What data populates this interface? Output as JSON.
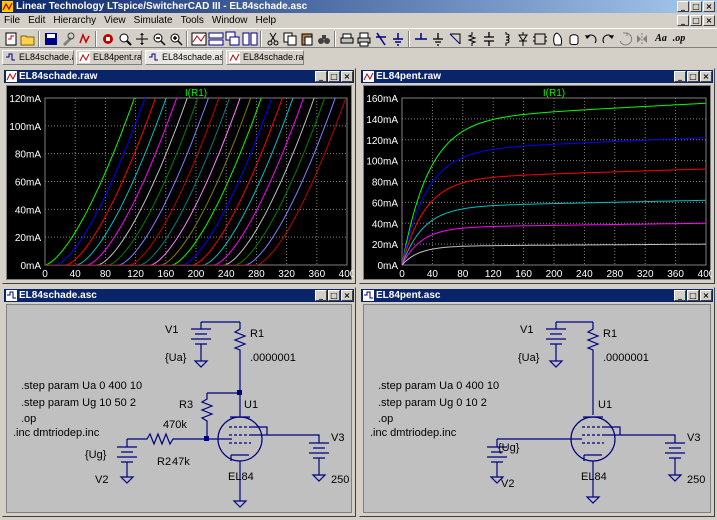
{
  "app": {
    "title": "Linear Technology LTspice/SwitcherCAD III - EL84schade.asc"
  },
  "menu": [
    "File",
    "Edit",
    "Hierarchy",
    "View",
    "Simulate",
    "Tools",
    "Window",
    "Help"
  ],
  "toolbar": {
    "icons": [
      "new-schematic-icon",
      "open-icon",
      "save-icon",
      "control-panel-icon",
      "run-icon",
      "halt-icon",
      "zoom-area-icon",
      "pan-icon",
      "zoom-out-icon",
      "zoom-fit-icon",
      "waveform-autorange-icon",
      "tile-horizontal-icon",
      "cascade-icon",
      "tile-vertical-icon",
      "cut-icon",
      "copy-icon",
      "paste-icon",
      "find-icon",
      "print-setup-icon",
      "print-icon",
      "undo-icon",
      "redo-icon",
      "wire-icon",
      "ground-icon",
      "label-icon",
      "resistor-icon",
      "capacitor-icon",
      "inductor-icon",
      "diode-icon",
      "component-icon",
      "move-icon",
      "drag-icon",
      "undo2-icon",
      "redo2-icon",
      "rotate-icon",
      "mirror-icon",
      "text-icon",
      "spice-directive-icon"
    ],
    "text_label": "Aa",
    "op_label": ".op"
  },
  "tabs": [
    {
      "label": "EL84schade.asc",
      "type": "schematic"
    },
    {
      "label": "EL84pent.raw",
      "type": "waveform"
    },
    {
      "label": "EL84schade.asc",
      "type": "schematic",
      "active": true
    },
    {
      "label": "EL84schade.raw",
      "type": "waveform"
    }
  ],
  "colors": {
    "accent": "#0a246a",
    "grid": "#808080",
    "wire": "#000080",
    "plot_bg": "#000000",
    "schem_bg": "#c0c0c0"
  },
  "windows": {
    "triode_plot": {
      "title": "EL84schade.raw",
      "trace_label": "I(R1)"
    },
    "pent_plot": {
      "title": "EL84pent.raw",
      "trace_label": "I(R1)"
    },
    "triode_schem": {
      "title": "EL84schade.asc",
      "v1": "V1",
      "v1_value": "{Ua}",
      "r1": "R1",
      "r1_value": ".0000001",
      "r3": "R3",
      "r3_value": "470k",
      "r2": "R2",
      "r2_value": "47k",
      "u1": "U1",
      "u1_value": "EL84",
      "v2": "V2",
      "v2_value": "{Ug}",
      "v3": "V3",
      "v3_value": "250",
      "directives": [
        ".step param Ua 0 400 10",
        ".step param Ug 10 50 2",
        ".op",
        ".inc dmtriodep.inc"
      ]
    },
    "pent_schem": {
      "title": "EL84pent.asc",
      "v1": "V1",
      "v1_value": "{Ua}",
      "r1": "R1",
      "r1_value": ".0000001",
      "u1": "U1",
      "u1_value": "EL84",
      "v2": "V2",
      "v2_value": "{Ug}",
      "v3": "V3",
      "v3_value": "250",
      "directives": [
        ".step param Ua 0 400 10",
        ".step param Ug 0 10 2",
        ".op",
        ".inc dmtriodep.inc"
      ]
    }
  },
  "chart_data": [
    {
      "type": "line",
      "title": "I(R1)",
      "xlabel": "",
      "ylabel": "",
      "xlim": [
        0,
        400
      ],
      "ylim": [
        0,
        120
      ],
      "x_ticks": [
        0,
        40,
        80,
        120,
        160,
        200,
        240,
        280,
        320,
        360,
        400
      ],
      "y_ticks": [
        "0mA",
        "20mA",
        "40mA",
        "60mA",
        "80mA",
        "100mA",
        "120mA"
      ],
      "grid": true,
      "curve_offsets_V": [
        0,
        14,
        28,
        42,
        56,
        70,
        84,
        98,
        112,
        126,
        140,
        154,
        168,
        182,
        196,
        210,
        224,
        238,
        252,
        266,
        280
      ],
      "slope_mA_per_V": 1.02,
      "exponent": 1.5,
      "series_colors": [
        "#00ff00",
        "#0000ff",
        "#ff0000",
        "#00c0c0",
        "#ff00ff",
        "#c0c0c0",
        "#008000",
        "#8080ff",
        "#c00000",
        "#008080",
        "#ff80ff",
        "#808000"
      ]
    },
    {
      "type": "line",
      "title": "I(R1)",
      "xlabel": "",
      "ylabel": "",
      "xlim": [
        0,
        400
      ],
      "ylim": [
        0,
        160
      ],
      "x_ticks": [
        0,
        40,
        80,
        120,
        160,
        200,
        240,
        280,
        320,
        360,
        400
      ],
      "y_ticks": [
        "0mA",
        "20mA",
        "40mA",
        "60mA",
        "80mA",
        "100mA",
        "120mA",
        "140mA",
        "160mA"
      ],
      "grid": true,
      "series": [
        {
          "color": "#00ff00",
          "final_mA": 155,
          "knee_V": 35
        },
        {
          "color": "#0000ff",
          "final_mA": 122,
          "knee_V": 32
        },
        {
          "color": "#ff0000",
          "final_mA": 92,
          "knee_V": 30
        },
        {
          "color": "#00c0c0",
          "final_mA": 62,
          "knee_V": 28
        },
        {
          "color": "#ff00ff",
          "final_mA": 40,
          "knee_V": 25
        },
        {
          "color": "#c0c0c0",
          "final_mA": 20,
          "knee_V": 22
        }
      ]
    }
  ]
}
